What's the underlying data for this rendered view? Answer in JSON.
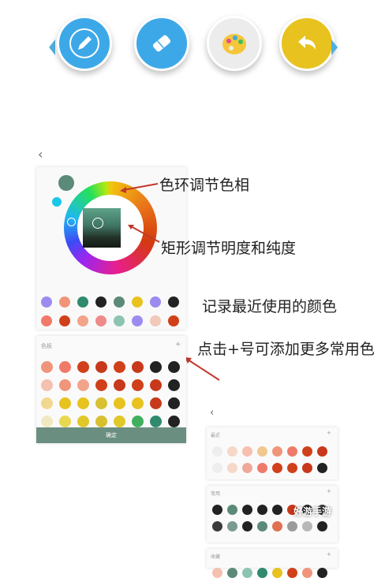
{
  "toolbar": {
    "buttons": [
      {
        "name": "pencil",
        "icon": "pencil-icon",
        "color": "#3da8e8"
      },
      {
        "name": "eraser",
        "icon": "eraser-icon",
        "color": "#3da8e8"
      },
      {
        "name": "palette",
        "icon": "palette-icon",
        "color": "#ececec"
      },
      {
        "name": "undo",
        "icon": "undo-icon",
        "color": "#e8c21f"
      }
    ]
  },
  "back_icon": "chevron-left-icon",
  "annotations": {
    "hue_ring": "色环调节色相",
    "rect_sv": "矩形调节明度和纯度",
    "recent": "记录最近使用的颜色",
    "add_more": "点击+号可添加更多常用色"
  },
  "picker": {
    "current_color": "#5b8a78",
    "previous_color": "#19c8e8",
    "recent_row1": [
      "#9b8cf0",
      "#f0957a",
      "#2f8a6e",
      "#222222",
      "#5b8a78",
      "#e8c21f",
      "#9b8cf0",
      "#222222"
    ],
    "recent_row2": [
      "#f07a6a",
      "#d0401a",
      "#f2a48a",
      "#f08a8a",
      "#8cc4b0",
      "#9b8cf0",
      "#f2c8b8",
      "#d0401a"
    ]
  },
  "palette_panel": {
    "title": "色板",
    "plus": "+",
    "confirm_label": "确定",
    "rows": [
      [
        "#f0957a",
        "#f07a6a",
        "#d0401a",
        "#c8381a",
        "#d0401a",
        "#c8381a",
        "#222222",
        "#222222"
      ],
      [
        "#f5c0b0",
        "#f0957a",
        "#f2a48a",
        "#d0401a",
        "#c8381a",
        "#d0401a",
        "#c8381a",
        "#222222"
      ],
      [
        "#f0d890",
        "#e8c21f",
        "#e8c21f",
        "#d8c030",
        "#e8c21f",
        "#e8c21f",
        "#c8381a",
        "#222222"
      ],
      [
        "#f0e8c0",
        "#e8d850",
        "#e0c828",
        "#d8c030",
        "#e0c828",
        "#40b060",
        "#2f8a6e",
        "#222222"
      ]
    ]
  },
  "mini_panels": [
    {
      "title": "最近",
      "plus": "+",
      "rows": [
        [
          "#eeeeee",
          "#f5d8c8",
          "#f5c0b0",
          "#f0c890",
          "#f0957a",
          "#f07a6a",
          "#d0401a",
          "#c8381a"
        ],
        [
          "#eeeeee",
          "#f5d8c8",
          "#f0a898",
          "#f07a6a",
          "#d0401a",
          "#d0401a",
          "#c8381a",
          "#222222"
        ]
      ]
    },
    {
      "title": "常用",
      "plus": "+",
      "rows": [
        [
          "#222222",
          "#5b8a78",
          "#222222",
          "#222222",
          "#222222",
          "#c8381a",
          "#222222",
          "#3a3a3a"
        ],
        [
          "#3a3a3a",
          "#7a9a8e",
          "#222222",
          "#5b8a78",
          "#e07050",
          "#9a9a9a",
          "#b8b8b8",
          "#222222"
        ]
      ]
    },
    {
      "title": "收藏",
      "plus": "+",
      "rows": [
        [
          "#f5c0b0",
          "#5b8a78",
          "#8cc4b0",
          "#2f8a6e",
          "#e8c21f",
          "#d0401a",
          "#f0957a",
          "#222222"
        ]
      ]
    }
  ],
  "watermark": "好游手游"
}
